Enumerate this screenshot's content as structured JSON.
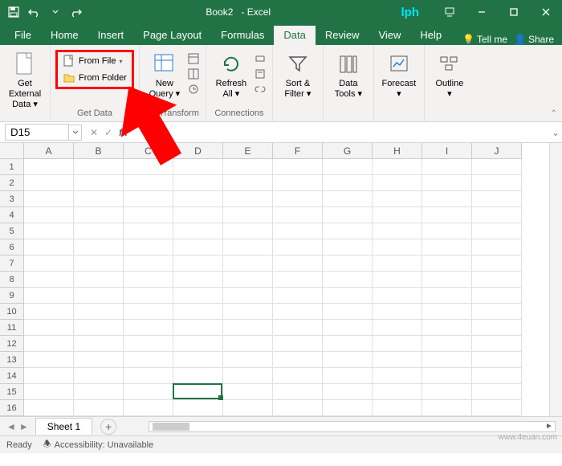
{
  "title_bar": {
    "doc_name": "Book2",
    "app_name": "- Excel",
    "logo": "lph"
  },
  "tabs": {
    "items": [
      "File",
      "Home",
      "Insert",
      "Page Layout",
      "Formulas",
      "Data",
      "Review",
      "View",
      "Help"
    ],
    "active_index": 5,
    "tell_me": "Tell me",
    "share": "Share"
  },
  "ribbon": {
    "get_external": {
      "label": "Get External\nData ▾",
      "group": ""
    },
    "get_data": {
      "group": "Get Data",
      "from_file": "From File",
      "from_folder": "From Folder"
    },
    "new_query": {
      "label": "New\nQuery ▾",
      "group": "t & Transform"
    },
    "refresh": {
      "label": "Refresh\nAll ▾",
      "group": "Connections"
    },
    "sort_filter": {
      "label": "Sort &\nFilter ▾"
    },
    "data_tools": {
      "label": "Data\nTools ▾"
    },
    "forecast": {
      "label": "Forecast\n▾"
    },
    "outline": {
      "label": "Outline\n▾"
    }
  },
  "formula_bar": {
    "name_box": "D15",
    "value": ""
  },
  "grid": {
    "columns": [
      "A",
      "B",
      "C",
      "D",
      "E",
      "F",
      "G",
      "H",
      "I",
      "J"
    ],
    "row_count": 16,
    "selected_cell": "D15"
  },
  "sheet_tabs": {
    "active": "Sheet 1"
  },
  "status_bar": {
    "mode": "Ready",
    "accessibility": "Accessibility: Unavailable"
  },
  "watermark": "www.4euan.com"
}
